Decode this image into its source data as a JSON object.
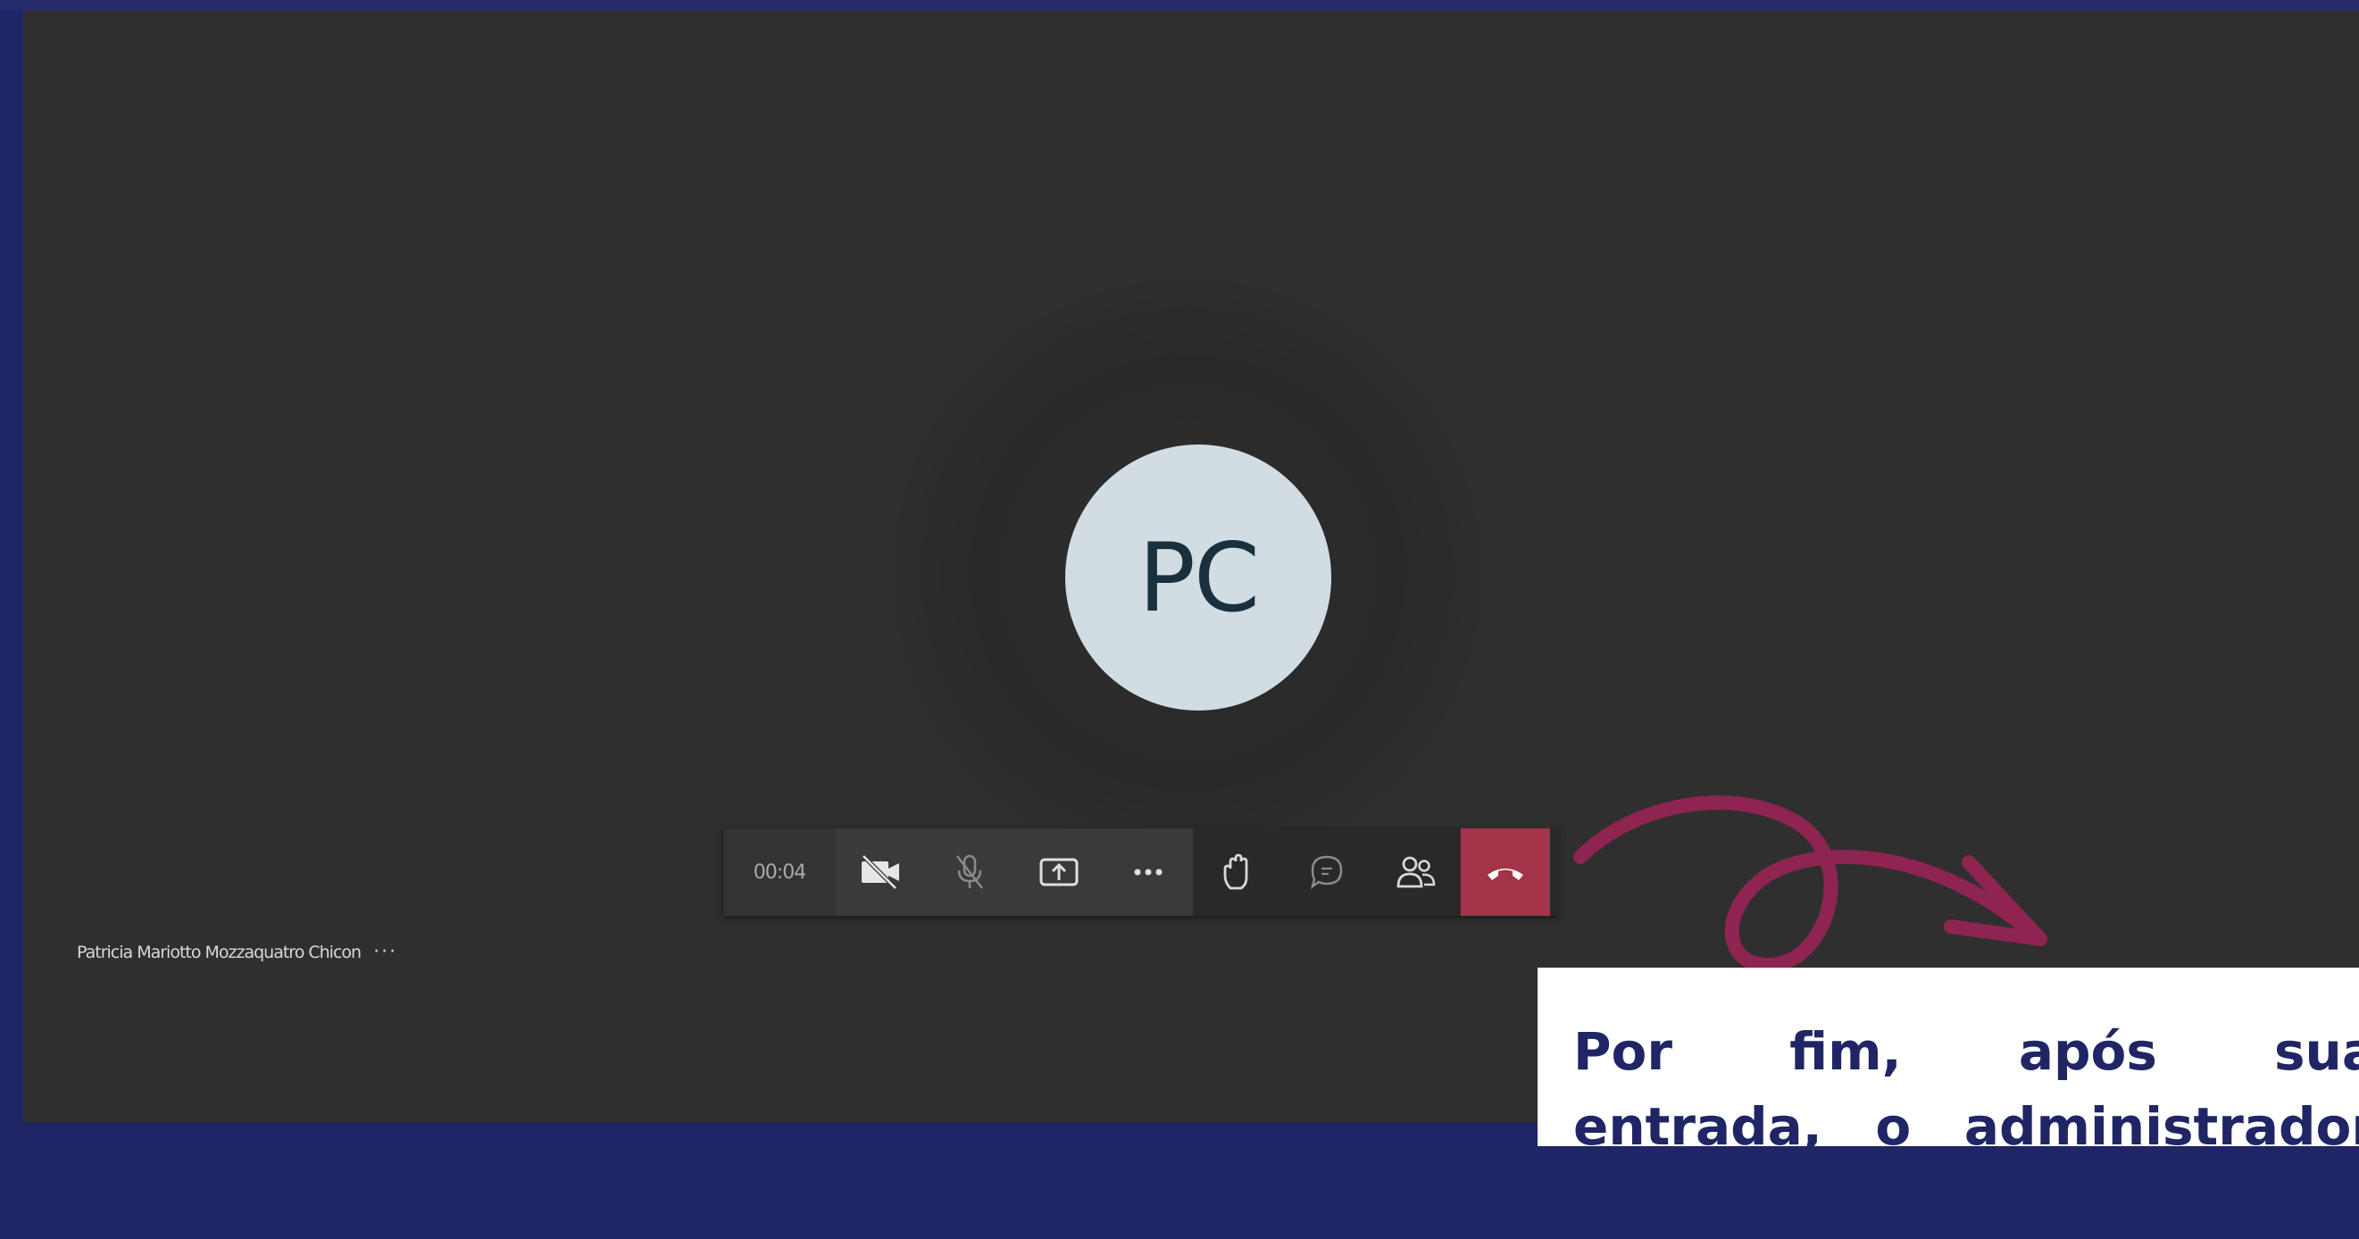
{
  "call": {
    "avatar_initials": "PC",
    "timer": "00:04",
    "participant_name": "Patricia Mariotto Mozzaquatro Chicon",
    "participant_more": "···"
  },
  "toolbar": {
    "buttons": [
      {
        "name": "camera-off-button",
        "icon": "video-off-icon"
      },
      {
        "name": "mic-off-button",
        "icon": "mic-off-icon"
      },
      {
        "name": "share-screen-button",
        "icon": "share-screen-icon"
      },
      {
        "name": "more-actions-button",
        "icon": "more-icon"
      },
      {
        "name": "raise-hand-button",
        "icon": "hand-icon"
      },
      {
        "name": "chat-button",
        "icon": "chat-icon"
      },
      {
        "name": "participants-button",
        "icon": "people-icon"
      },
      {
        "name": "hang-up-button",
        "icon": "phone-hangup-icon"
      }
    ]
  },
  "caption": {
    "text": "Por fim, após sua entrada, o administrador da sala"
  },
  "colors": {
    "frame": "#1f2565",
    "stage": "#2f2f30",
    "hangup": "#a4334a",
    "arrow": "#8e2450",
    "caption_text": "#1f2565"
  }
}
